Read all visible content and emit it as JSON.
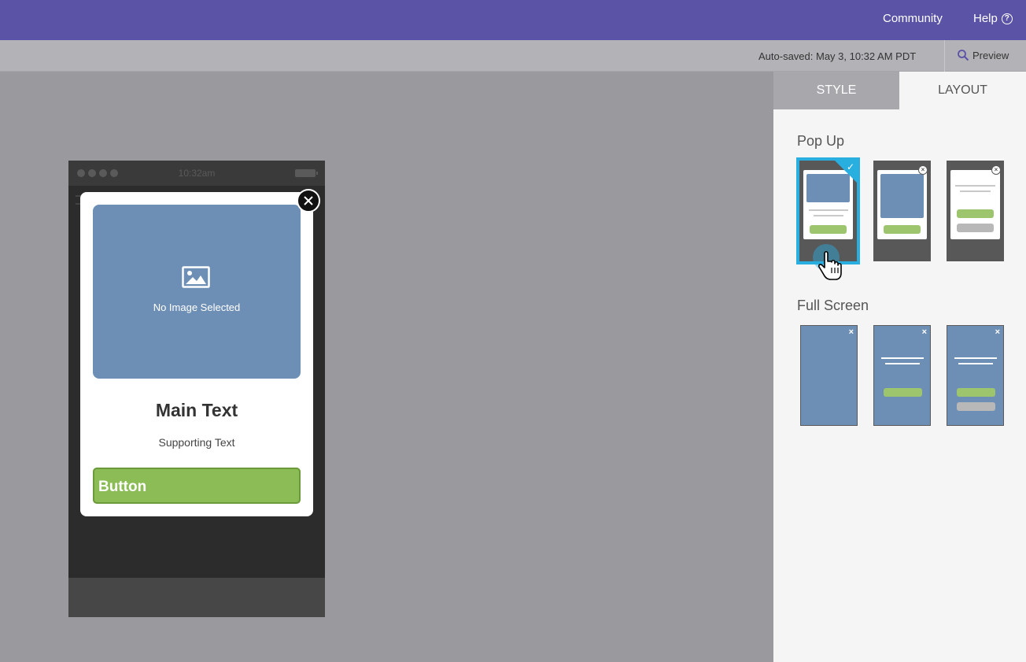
{
  "header": {
    "community_label": "Community",
    "help_label": "Help",
    "help_icon": "?"
  },
  "toolbar": {
    "autosave_text": "Auto-saved: May 3, 10:32 AM PDT",
    "preview_label": "Preview"
  },
  "phone": {
    "time": "10:32am"
  },
  "popup": {
    "no_image_text": "No Image Selected",
    "main_text": "Main Text",
    "supporting_text": "Supporting Text",
    "button_label": "Button",
    "close_icon": "×"
  },
  "panel": {
    "tabs": [
      {
        "label": "STYLE",
        "active": false
      },
      {
        "label": "LAYOUT",
        "active": true
      }
    ],
    "sections": {
      "popup_title": "Pop Up",
      "fullscreen_title": "Full Screen"
    },
    "selected_layout": "popup-1",
    "close_glyph": "×",
    "check_glyph": "✓"
  },
  "colors": {
    "header_purple": "#5b53a5",
    "accent_blue": "#29aee0",
    "image_blue": "#6e8fb5",
    "button_green": "#8bbc56"
  }
}
